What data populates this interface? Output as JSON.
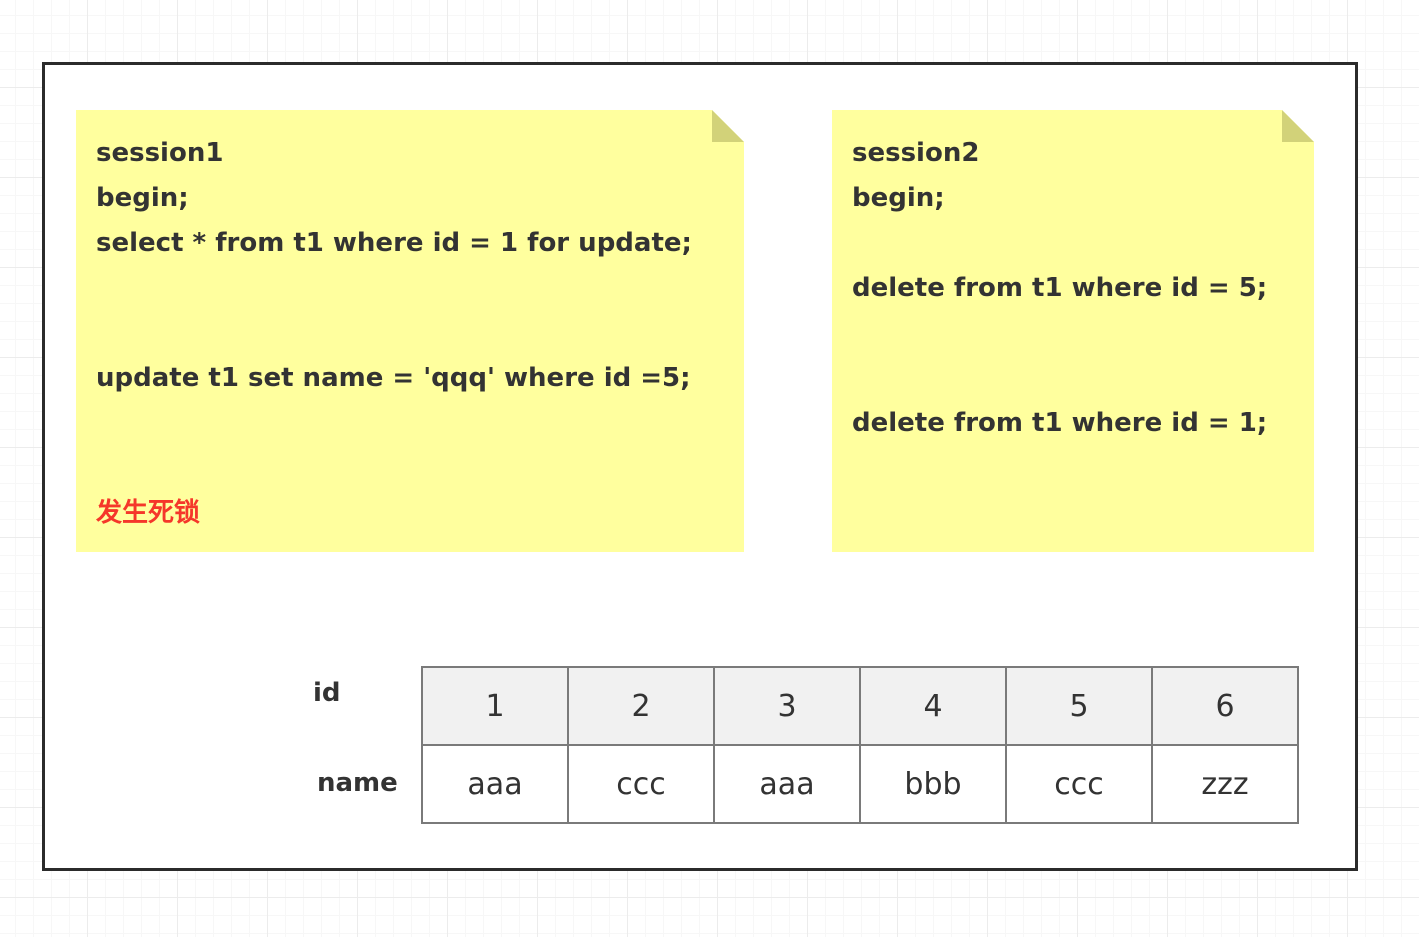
{
  "session1": {
    "lines": [
      "session1",
      "begin;",
      "select * from t1 where id = 1 for update;",
      "update t1 set name = 'qqq' where id =5;"
    ],
    "deadlock_label": "发生死锁",
    "deadlock_color": "#f5372a"
  },
  "session2": {
    "lines": [
      "session2",
      "begin;",
      "delete from t1 where id = 5;",
      "delete from t1 where id = 1;"
    ]
  },
  "table": {
    "id_label": "id",
    "name_label": "name",
    "ids": [
      "1",
      "2",
      "3",
      "4",
      "5",
      "6"
    ],
    "names": [
      "aaa",
      "ccc",
      "aaa",
      "bbb",
      "ccc",
      "zzz"
    ]
  },
  "colors": {
    "note_fill": "#ffff9e",
    "note_fold": "#d2d279",
    "frame_border": "#2b2b2b",
    "id_row_fill": "#f1f1f1"
  }
}
